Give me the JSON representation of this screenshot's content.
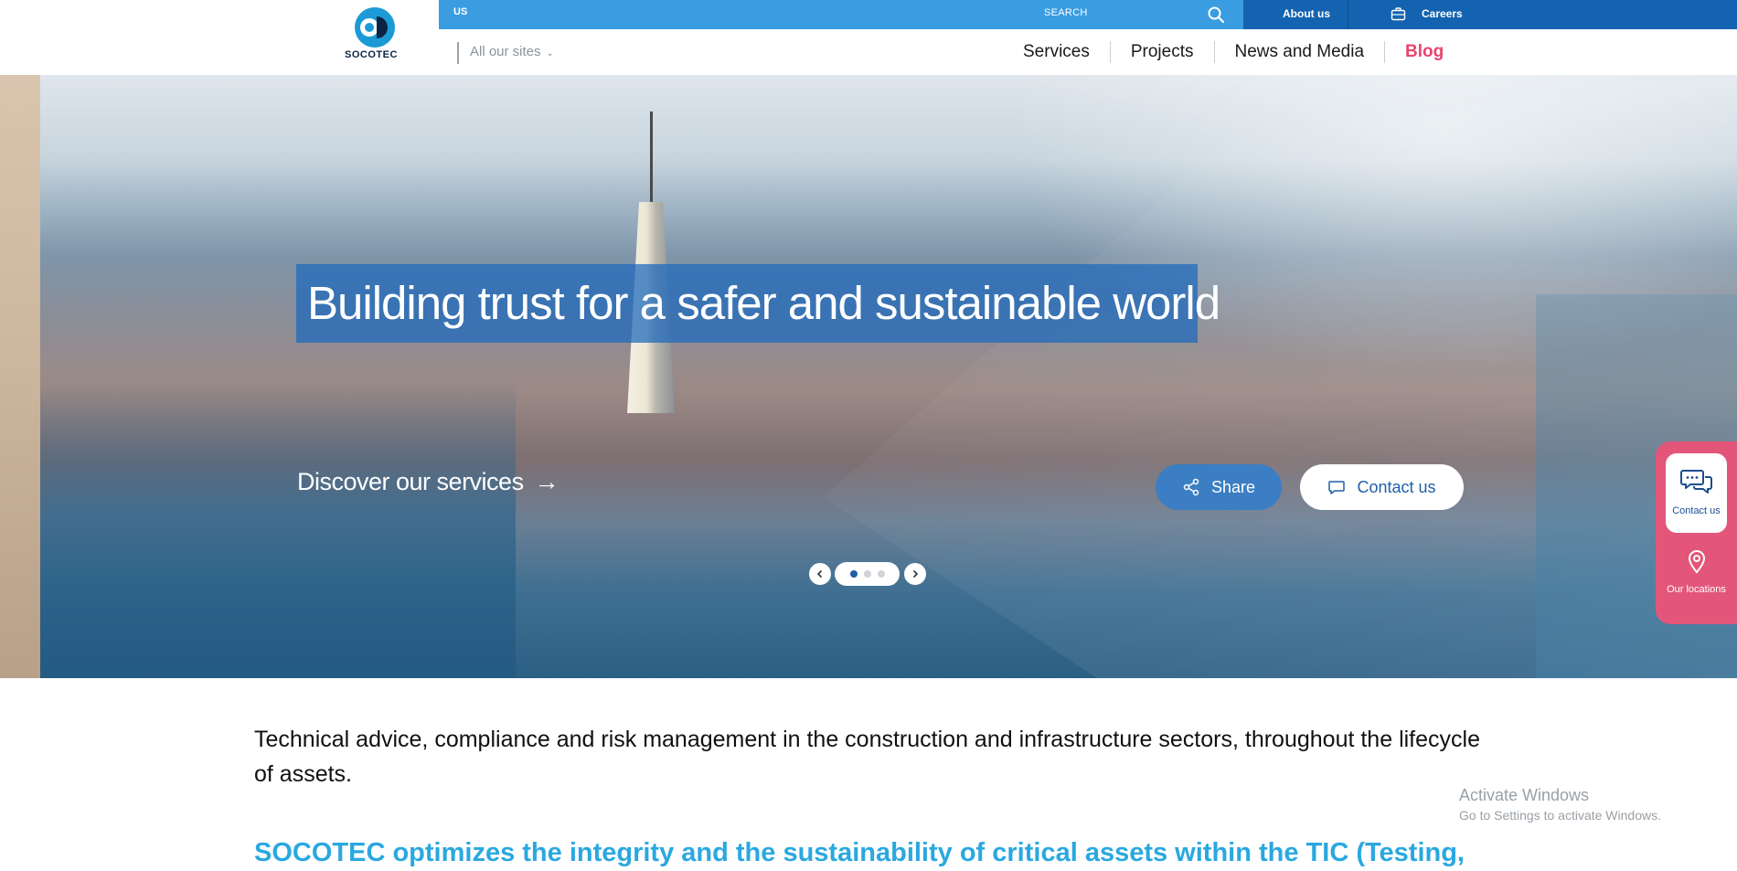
{
  "topbar": {
    "region": "US",
    "search_label": "SEARCH",
    "about_label": "About us",
    "careers_label": "Careers"
  },
  "logo": {
    "text": "SOCOTEC"
  },
  "nav": {
    "all_sites": "All our sites",
    "items": [
      {
        "label": "Services"
      },
      {
        "label": "Projects"
      },
      {
        "label": "News and Media"
      },
      {
        "label": "Blog"
      }
    ]
  },
  "hero": {
    "title": "Building trust for a safer and sustainable world",
    "discover": "Discover our services",
    "share_label": "Share",
    "contact_label": "Contact us",
    "slides_total": 3,
    "slide_active": 1
  },
  "side_panel": {
    "contact_label": "Contact us",
    "locations_label": "Our locations"
  },
  "body": {
    "intro": "Technical advice, compliance and risk management in the construction and infrastructure sectors, throughout the lifecycle of assets.",
    "subhead": "SOCOTEC optimizes the integrity and the sustainability of critical assets within the TIC (Testing,"
  },
  "watermark": {
    "title": "Activate Windows",
    "subtitle": "Go to Settings to activate Windows."
  },
  "colors": {
    "topbar_blue": "#3a9de1",
    "topbar_dark": "#1463b0",
    "blog_accent": "#e8456d",
    "side_panel": "#e3567a",
    "subhead": "#2aa8df"
  },
  "icons": {
    "search": "search-icon",
    "careers": "briefcase-icon",
    "share": "share-icon",
    "contact": "chat-bubble-icon",
    "location": "map-pin-icon"
  }
}
